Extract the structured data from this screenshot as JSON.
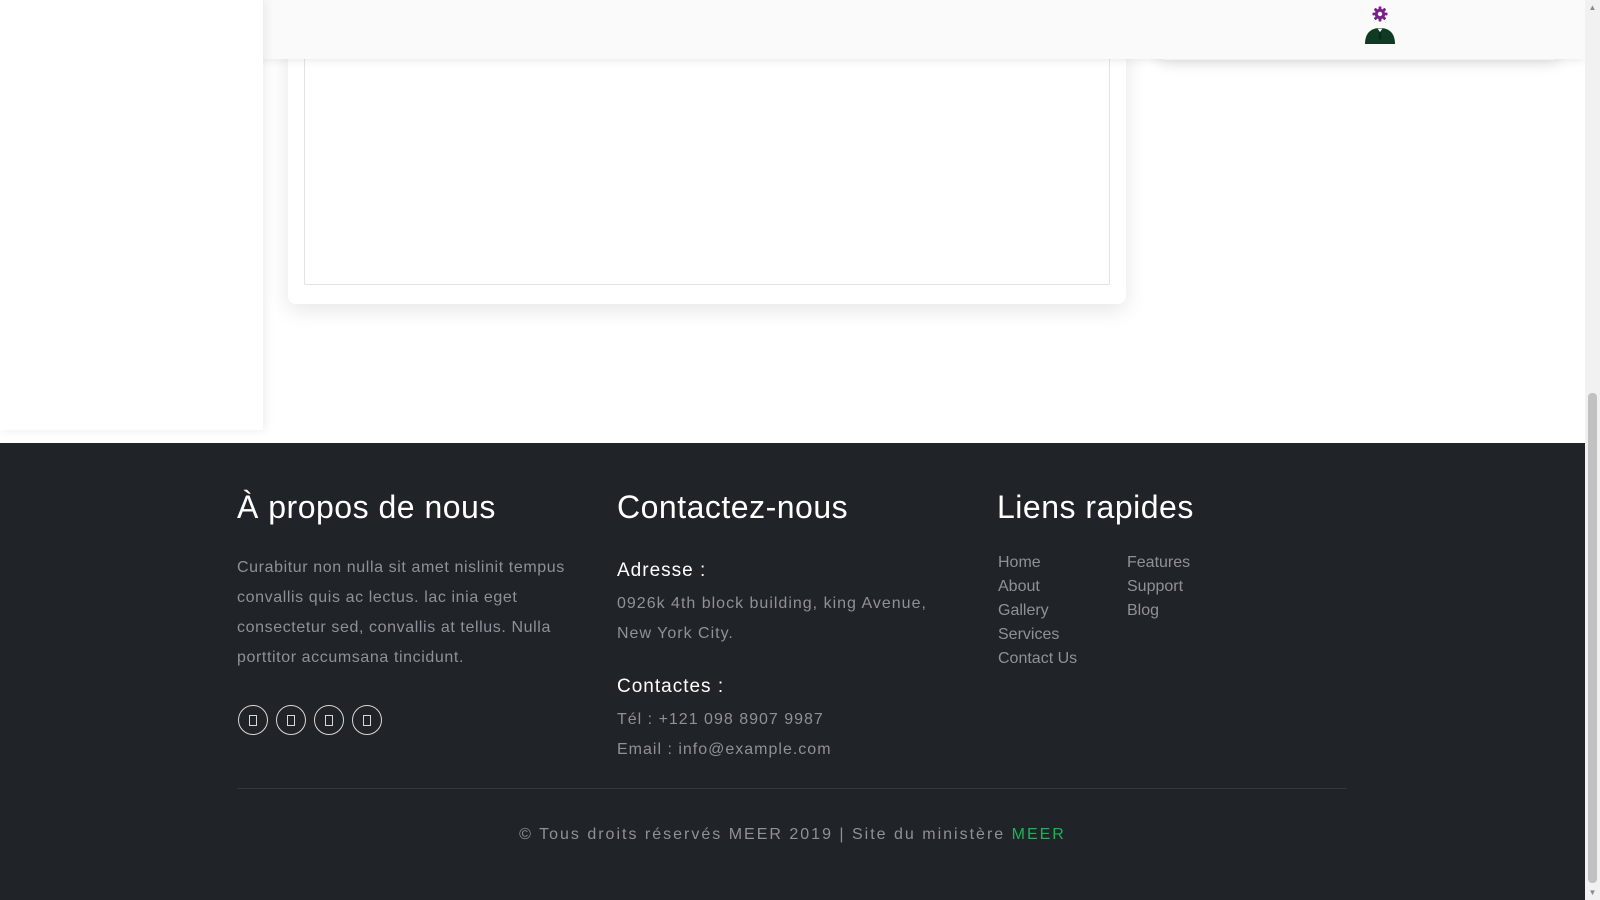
{
  "footer": {
    "about": {
      "title": "À propos de nous",
      "text": "Curabitur non nulla sit amet nislinit tempus convallis quis ac lectus. lac inia eget consectetur sed, convallis at tellus. Nulla porttitor accumsana tincidunt.",
      "socials": [
        "facebook-icon",
        "twitter-icon",
        "instagram-icon",
        "linkedin-icon"
      ]
    },
    "contact": {
      "title": "Contactez-nous",
      "address_label": "Adresse :",
      "address_line1": "0926k 4th block building, king Avenue,",
      "address_line2": "New York City.",
      "contacts_label": "Contactes :",
      "phone_prefix": "Tél : ",
      "phone": "+121 098 8907 9987",
      "email_prefix": "Email : ",
      "email": "info@example.com"
    },
    "links": {
      "title": "Liens rapides",
      "col1": [
        "Home",
        "About",
        "Gallery",
        "Services",
        "Contact Us"
      ],
      "col2": [
        "Features",
        "Support",
        "Blog"
      ]
    },
    "copyright_text": "© Tous droits réservés MEER 2019 | Site du ministère ",
    "copyright_link": "MEER"
  },
  "colors": {
    "footer_bg": "#202327",
    "accent": "#16b556",
    "avatar_gear": "#7a1f8c",
    "avatar_body": "#0f3a24"
  }
}
